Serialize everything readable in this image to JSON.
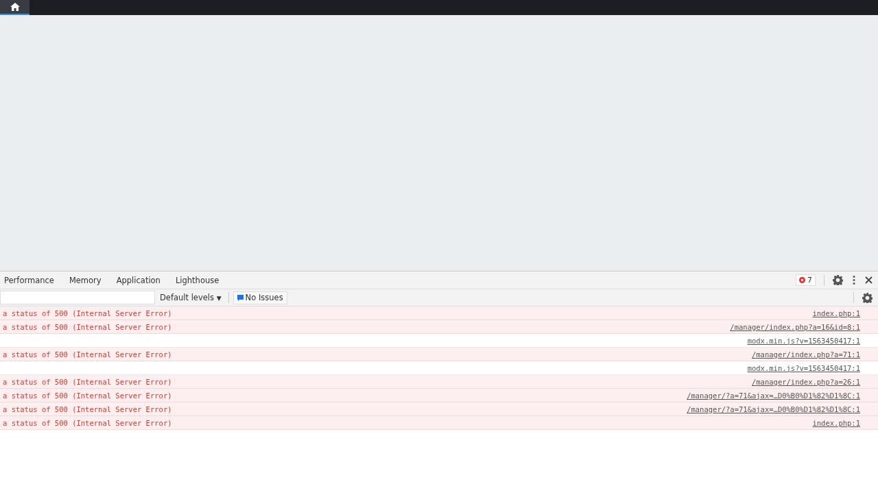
{
  "top_bar": {
    "tabs": [
      {
        "kind": "home",
        "selected": true
      }
    ]
  },
  "devtools": {
    "tabs": [
      {
        "label": "Performance",
        "selected": false
      },
      {
        "label": "Memory",
        "selected": false
      },
      {
        "label": "Application",
        "selected": false
      },
      {
        "label": "Lighthouse",
        "selected": false
      }
    ],
    "error_count": "7",
    "levels_dropdown": {
      "label": "Default levels",
      "caret": "▼"
    },
    "issues_button": {
      "label": "No Issues"
    },
    "messages": [
      {
        "kind": "error",
        "text": "a status of 500 (Internal Server Error)",
        "source": "index.php:1"
      },
      {
        "kind": "error",
        "text": "a status of 500 (Internal Server Error)",
        "source": "/manager/index.php?a=16&id=8:1"
      },
      {
        "kind": "log",
        "source": "modx.min.js?v=1563450417:1"
      },
      {
        "kind": "error",
        "text": "a status of 500 (Internal Server Error)",
        "source": "/manager/index.php?a=71:1"
      },
      {
        "kind": "log",
        "source": "modx.min.js?v=1563450417:1"
      },
      {
        "kind": "error",
        "text": "a status of 500 (Internal Server Error)",
        "source": "/manager/index.php?a=26:1"
      },
      {
        "kind": "error",
        "text": "a status of 500 (Internal Server Error)",
        "source": "/manager/?a=71&ajax=…D0%B0%D1%82%D1%8C:1"
      },
      {
        "kind": "error",
        "text": "a status of 500 (Internal Server Error)",
        "source": "/manager/?a=71&ajax=…D0%B0%D1%82%D1%8C:1"
      },
      {
        "kind": "error",
        "text": "a status of 500 (Internal Server Error)",
        "source": "index.php:1"
      }
    ]
  }
}
